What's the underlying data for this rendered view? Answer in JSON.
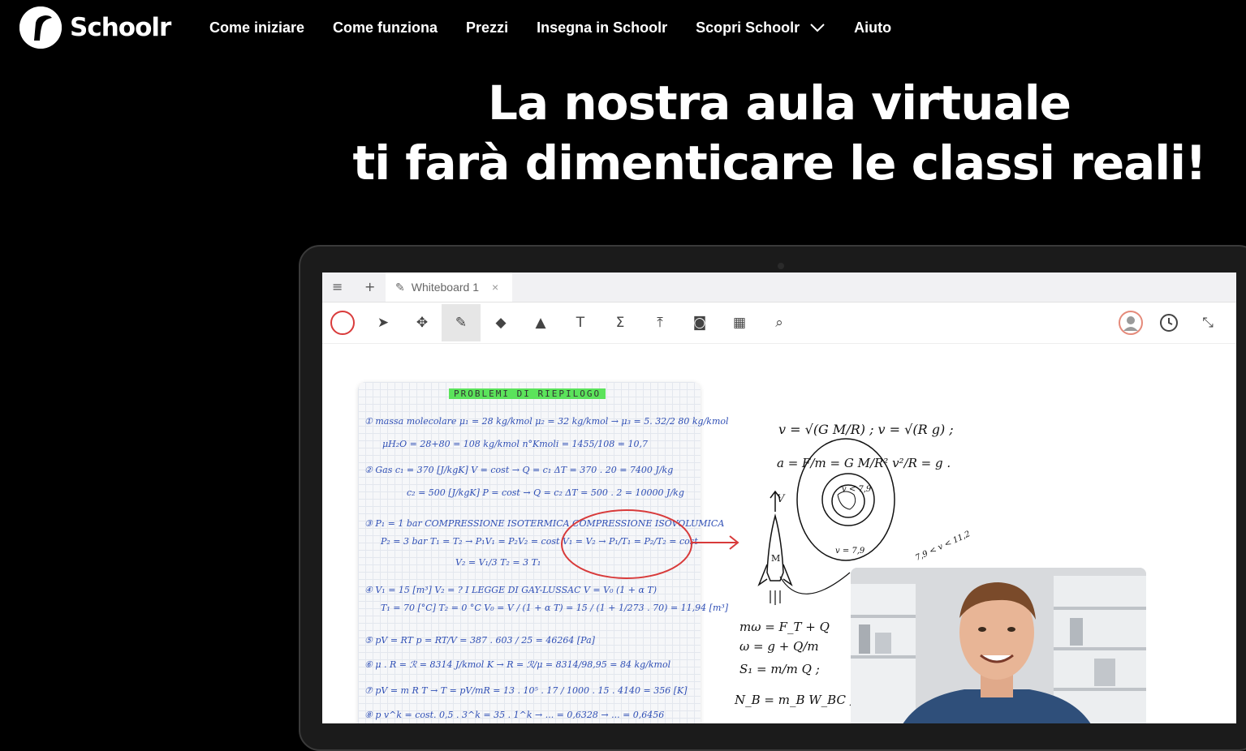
{
  "brand": {
    "name": "Schoolr"
  },
  "nav": [
    {
      "label": "Come iniziare"
    },
    {
      "label": "Come funziona"
    },
    {
      "label": "Prezzi"
    },
    {
      "label": "Insegna in Schoolr"
    },
    {
      "label": "Scopri Schoolr",
      "has_dropdown": true
    },
    {
      "label": "Aiuto"
    }
  ],
  "hero": {
    "line1": "La nostra aula virtuale",
    "line2": "ti farà dimenticare le classi reali!"
  },
  "app": {
    "tab_title": "Whiteboard 1",
    "toolbar": [
      "color",
      "select",
      "move",
      "pen",
      "eraser",
      "shapes",
      "text",
      "formula",
      "upload",
      "camera",
      "table",
      "zoom"
    ],
    "active_tool": "pen"
  },
  "whiteboard": {
    "notes_title": "PROBLEMI DI RIEPILOGO",
    "notes": [
      "① massa molecolare μ₁ = 28 kg/kmol   μ₂ = 32 kg/kmol → μ₃ = 5. 32/2 80 kg/kmol",
      "μH₂O = 28+80 = 108 kg/kmol   n°Kmoli = 1455/108 = 10,7",
      "② Gas  c₁ = 370 [J/kgK]   V = cost → Q = c₁ ΔT = 370 . 20 = 7400 J/kg",
      "c₂ = 500 [J/kgK]   P = cost → Q = c₂ ΔT = 500 . 2 = 10000 J/kg",
      "③ P₁ = 1 bar   COMPRESSIONE ISOTERMICA   COMPRESSIONE ISOVOLUMICA",
      "P₂ = 3 bar   T₁ = T₂ → P₁V₁ = P₂V₂ = cost   V₁ = V₂ → P₁/T₁ = P₂/T₂ = cost",
      "V₂ = V₁/3   T₂ = 3 T₁",
      "④ V₁ = 15 [m³]   V₂ = ?   I LEGGE DI GAY-LUSSAC   V = V₀ (1 + α T)",
      "T₁ = 70 [°C]   T₂ = 0 °C   V₀ = V / (1 + α T) = 15 / (1 + 1/273 . 70) = 11,94 [m³]",
      "⑤ pV = RT   p = RT/V = 387 . 603 / 25 = 46264 [Pa]",
      "⑥ μ . R = ℛ = 8314 J/kmol K → R = ℛ/μ = 8314/98,95 = 84 kg/kmol",
      "⑦ pV = m R T → T = pV/mR = 13 . 10⁵ . 17 / 1000 . 15 . 4140 = 356 [K]",
      "⑧ p v^k = cost.   0,5 . 3^k = 35 . 1^k → ... = 0,6328 → ... = 0,6456"
    ],
    "physics": [
      "v = √(G M/R) ;   v = √(R g) ;",
      "a = F/m = G M/R²   v²/R = g .",
      "V",
      "v < 7,9",
      "v = 7,9",
      "7,9 < v < 11,2",
      "M",
      "mω = F_T + Q",
      "ω = g + Q/m",
      "S₁ = m/m Q ;",
      "N_B = m_B W_BC ;"
    ]
  }
}
